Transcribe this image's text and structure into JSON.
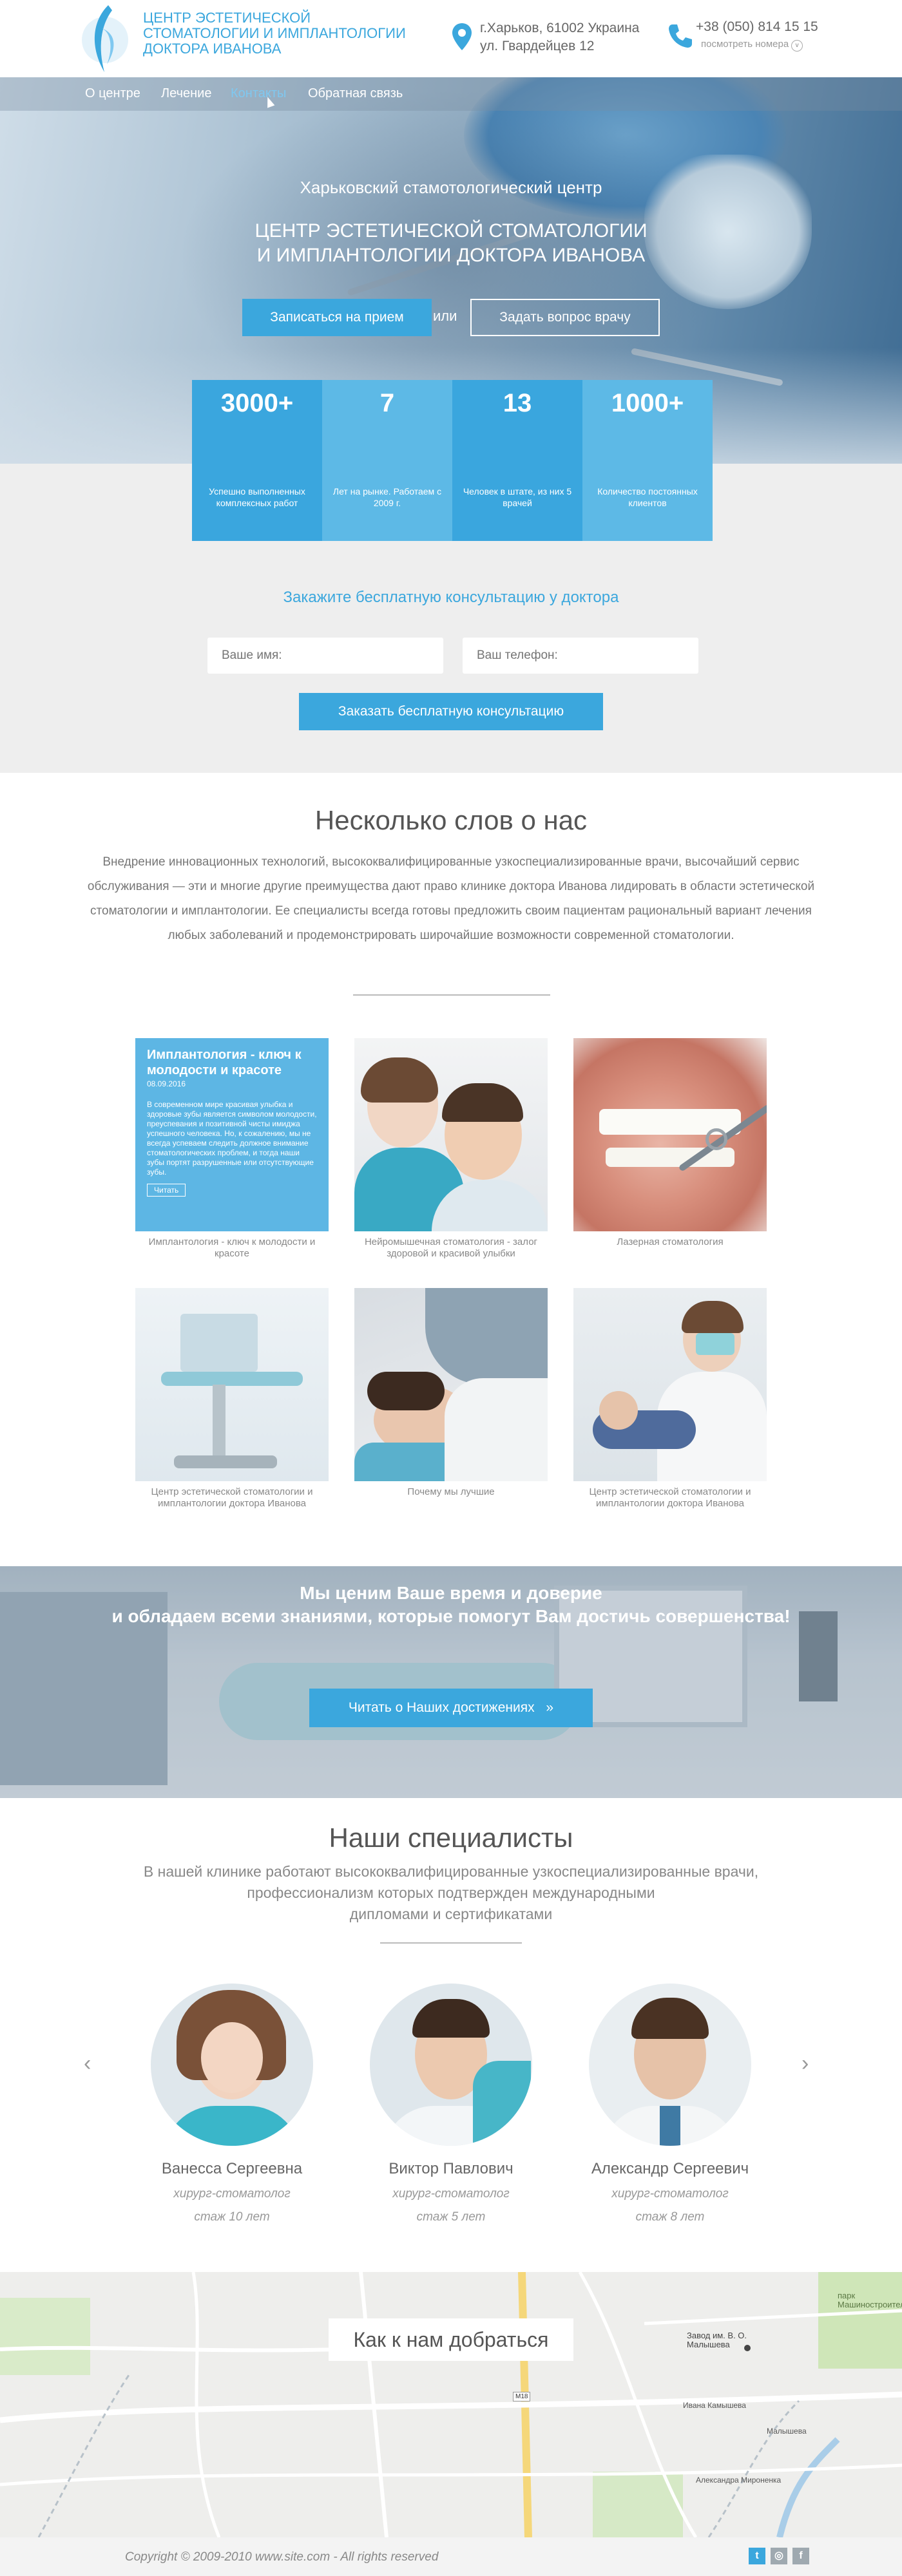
{
  "header": {
    "logo_text": "Центр эстетической стоматологии и имплантологии доктора Иванова",
    "address_line1": "г.Харьков, 61002 Украина",
    "address_line2": "ул. Гвардейцев 12",
    "phone": "+38 (050) 814 15 15",
    "phone_more": "посмотреть номера"
  },
  "nav": {
    "items": [
      {
        "label": "О центре"
      },
      {
        "label": "Лечение"
      },
      {
        "label": "Контакты"
      },
      {
        "label": "Обратная связь"
      }
    ],
    "active_index": 2
  },
  "hero": {
    "subtitle": "Харьковский стамотологический центр",
    "title_line1": "ЦЕНТР ЭСТЕТИЧЕСКОЙ СТОМАТОЛОГИИ",
    "title_line2": "И ИМПЛАНТОЛОГИИ ДОКТОРА ИВАНОВА",
    "btn_appointment": "Записаться на прием",
    "or": "или",
    "btn_question": "Задать вопрос врачу"
  },
  "stats": [
    {
      "num": "3000+",
      "label": "Успешно выполненных комплексных работ"
    },
    {
      "num": "7",
      "label": "Лет на рынке. Работаем с 2009 г."
    },
    {
      "num": "13",
      "label": "Человек в штате, из них 5 врачей"
    },
    {
      "num": "1000+",
      "label": "Количество постоянных клиентов"
    }
  ],
  "consult": {
    "title": "Закажите бесплатную консультацию у доктора",
    "name_placeholder": "Ваше имя:",
    "phone_placeholder": "Ваш телефон:",
    "button": "Заказать бесплатную консультацию"
  },
  "about": {
    "title": "Несколько слов о нас",
    "text": "Внедрение инновационных технологий, высококвалифицированные узкоспециализированные врачи, высочайший сервис обслуживания — эти и многие другие преимущества дают право клинике доктора Иванова лидировать в области эстетической стоматологии и имплантологии. Ее специалисты всегда готовы предложить своим пациентам рациональный вариант лечения любых заболеваний и продемонстрировать широчайшие возможности современной стоматологии."
  },
  "news_card": {
    "title": "Имплантология - ключ к молодости и красоте",
    "date": "08.09.2016",
    "text": "В современном мире красивая улыбка и здоровые зубы является символом молодости, преуспевания и позитивной чисты имиджа успешного человека. Но, к сожалению, мы не всегда успеваем следить должное внимание стоматологических проблем, и тогда наши зубы портят разрушенные или отсутствующие зубы.",
    "read": "Читать"
  },
  "gallery": [
    {
      "caption": "Имплантология - ключ к молодости и красоте"
    },
    {
      "caption": "Нейромышечная стоматология - залог здоровой и красивой улыбки"
    },
    {
      "caption": "Лазерная стоматология"
    },
    {
      "caption": "Центр эстетической стоматологии и имплантологии доктора Иванова"
    },
    {
      "caption": "Почему мы лучшие"
    },
    {
      "caption": "Центр эстетической стоматологии и имплантологии доктора Иванова"
    }
  ],
  "banner": {
    "line1": "Мы ценим Ваше время и доверие",
    "line2": "и обладаем всеми знаниями, которые помогут Вам достичь совершенства!",
    "button": "Читать о Наших достижениях",
    "button_icon": "»"
  },
  "specialists": {
    "title": "Наши специалисты",
    "text_line1": "В нашей клинике работают высококвалифицированные узкоспециализированные врачи,",
    "text_line2": "профессионализм которых подтвержден международными",
    "text_line3": "дипломами и сертификатами",
    "prev": "‹",
    "next": "›",
    "doctors": [
      {
        "name": "Ванесса Сергеевна",
        "role": "хирург-стоматолог",
        "exp": "стаж 10 лет"
      },
      {
        "name": "Виктор Павлович",
        "role": "хирург-стоматолог",
        "exp": "стаж 5 лет"
      },
      {
        "name": "Александр Сергеевич",
        "role": "хирург-стоматолог",
        "exp": "стаж 8 лет"
      }
    ]
  },
  "map": {
    "title": "Как к нам добраться",
    "labels": {
      "plant": "Завод им. В. О. Малышева",
      "park": "парк Машиностроителей",
      "road": "М18",
      "street1": "Ивана Камышева",
      "street2": "Александра Мироненка",
      "street3": "Малышева"
    }
  },
  "footer": {
    "copyright": "Copyright © 2009-2010 www.site.com - All rights reserved",
    "social": [
      {
        "name": "twitter",
        "glyph": "t",
        "color": "#3ba7dd"
      },
      {
        "name": "instagram",
        "glyph": "◎",
        "color": "#9fa9b0"
      },
      {
        "name": "facebook",
        "glyph": "f",
        "color": "#9fa9b0"
      }
    ]
  },
  "colors": {
    "accent": "#3ba7dd",
    "stat_dark": "#3aa6de",
    "stat_light": "#5db9e6"
  }
}
